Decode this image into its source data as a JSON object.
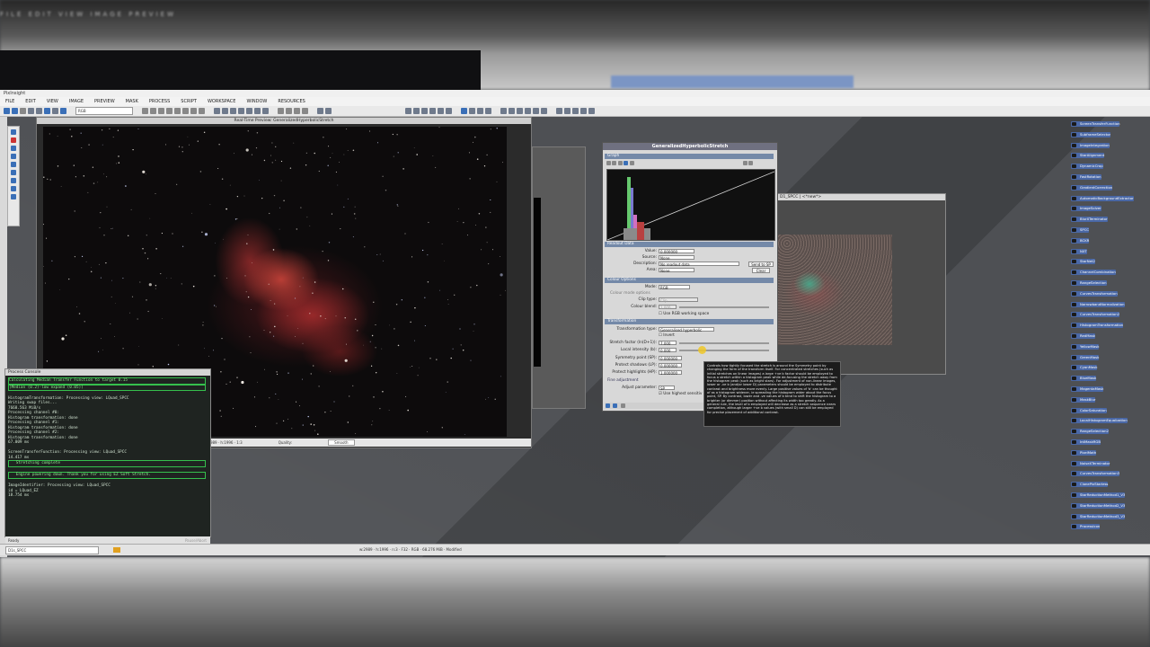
{
  "background": {
    "menu_blurred": "FILE  EDIT  VIEW  IMAGE  PREVIEW"
  },
  "app": {
    "title": "PixInsight",
    "menu": [
      "FILE",
      "EDIT",
      "VIEW",
      "IMAGE",
      "PREVIEW",
      "MASK",
      "PROCESS",
      "SCRIPT",
      "WORKSPACE",
      "WINDOW",
      "RESOURCES"
    ],
    "toolbar_select": "RGB",
    "accent": "#3a6fb7"
  },
  "image_window": {
    "title": "Real-Time Preview: GeneralizedHyperbolicStretch",
    "status_coords": "w:2989 · h:1996 · 1:3",
    "quality_label": "Quality:",
    "quality_value": "Smooth"
  },
  "ghs": {
    "title": "GeneralizedHyperbolicStretch",
    "graph_section": "Graph",
    "readout_section": "Readout Data",
    "value_label": "Value:",
    "value": "0.000000",
    "source_label": "Source:",
    "source": "None",
    "description_label": "Description:",
    "description": "No readout data",
    "area_label": "Area:",
    "area": "None",
    "send_btn": "Send to SP",
    "clear_btn": "Clear",
    "colour_section": "Colour Options",
    "mode_label": "Mode:",
    "mode": "RGB",
    "colour_mode_options": "Colour mode options",
    "clip_label": "Clip type:",
    "clip": "Clip",
    "blend_label": "Colour blend:",
    "blend": "1.000",
    "use_rgb": "Use RGB working space",
    "transform_section": "Transformation",
    "ttype_label": "Transformation type:",
    "ttype": "Generalised hyperbolic",
    "invert": "Invert",
    "stretch_label": "Stretch factor (ln(D+1)):",
    "stretch": "7.000",
    "local_label": "Local intensity (b):",
    "local": "0.000",
    "sp_label": "Symmetry point (SP):",
    "sp": "0.000000",
    "shadow_label": "Protect shadows (LP):",
    "shadow": "0.000000",
    "highlight_label": "Protect highlights (HP):",
    "highlight": "1.000000",
    "adjust_section": "Fine adjustment",
    "adjust_label": "Adjust parameter:",
    "adjust": "SP",
    "highest_label": "Use highest sensitiv"
  },
  "tooltip": "Controls how tightly focused the stretch is around the Symmetry point by changing the form of the transform itself. For concentrated stretches (such as initial stretches on linear images) a large +ve b factor should be employed to focus a stretch within a histogram peak while de-focusing the stretch away from the histogram peak (such as bright stars). For adjustment of non-linear images, lower or -ve b (and/or lower D) parameters should be employed to distribute contrast and brightness more evenly. Large positive values of 'b' can be thought of as a histogram widener, ie spreading the histogram wider about the focus point, SP. By contrast, lower and -ve values of b tend to shift the histogram to a brighter (or dimmer) position without affecting its width too greatly. As a general rule, the level of b employed will decrease as a stretch sequence nears completion, although larger +ve b values (with small D) can still be employed for precise placement of additional contrast.",
  "spcc_window": {
    "title": "D1_SPCC | <*new*>"
  },
  "console": {
    "title": "Process Console",
    "lines": [
      {
        "t": "Calculating Median Transfer Function to target 0.15",
        "box": true
      },
      {
        "t": "(Median (0.2)-low expand (0.05))",
        "box": true
      },
      {
        "t": "",
        "box": false
      },
      {
        "t": "HistogramTransformation: Processing view: LQuad_SPCC",
        "box": false
      },
      {
        "t": "Writing swap files...",
        "box": false
      },
      {
        "t": "7668.563 MiB/s",
        "box": false
      },
      {
        "t": "Processing channel #0:",
        "box": false
      },
      {
        "t": "Histogram transformation: done",
        "box": false
      },
      {
        "t": "Processing channel #1:",
        "box": false
      },
      {
        "t": "Histogram transformation: done",
        "box": false
      },
      {
        "t": "Processing channel #2:",
        "box": false
      },
      {
        "t": "Histogram transformation: done",
        "box": false
      },
      {
        "t": "67.009 ms",
        "box": false
      },
      {
        "t": "",
        "box": false
      },
      {
        "t": "ScreenTransferFunction: Processing view: LQuad_SPCC",
        "box": false
      },
      {
        "t": "14.417 ms",
        "box": false
      },
      {
        "t": "   Stretching complete",
        "box": true
      },
      {
        "t": "",
        "box": false
      },
      {
        "t": "   Engine powering down. Thank you for using EZ Soft Stretch.",
        "box": true
      },
      {
        "t": "",
        "box": false
      },
      {
        "t": "ImageIdentifier: Processing view: LQuad_SPCC",
        "box": false
      },
      {
        "t": "id = LQuad_EZ",
        "box": false
      },
      {
        "t": "18.754 ms",
        "box": false
      }
    ],
    "status": "Ready",
    "pause_btn": "Pause/Abort"
  },
  "bottom_bar": {
    "view_select": "D1s_SPCC",
    "info": "w:2989 · h:1996 · n:3 · F32 · RGB · 68.276 MiB · Modified"
  },
  "explorer": [
    "ScreenTransferFunction",
    "SubframeSelector",
    "ImageIntegration",
    "StarAlignment",
    "DynamicCrop",
    "FastRotation",
    "GradientCorrection",
    "AutomaticBackgroundExtractor",
    "ImageSolver",
    "BlurXTerminator",
    "SPCC",
    "BCKR",
    "NXT",
    "StarNet2",
    "ChannelCombination",
    "RangeSelection",
    "CurvesTransformation",
    "NarrowbandNormalization",
    "CurvesTransformation2",
    "HistogramTransformation",
    "RedMask",
    "YellowMask",
    "GreenMask",
    "CyanMask",
    "BlueMask",
    "MagentaMask",
    "MaskBlur",
    "ColorSaturation",
    "LocalHistogramEqualization",
    "RangeSelection2",
    "IntMaskRGB",
    "PixelMath",
    "NoiseXTerminator",
    "CurvesTransformation3",
    "ClonePixStarless",
    "StarReductionMethod1_V3",
    "StarReductionMethod2_V3",
    "StarReductionMethod3_V3",
    "ProcessIcon"
  ]
}
